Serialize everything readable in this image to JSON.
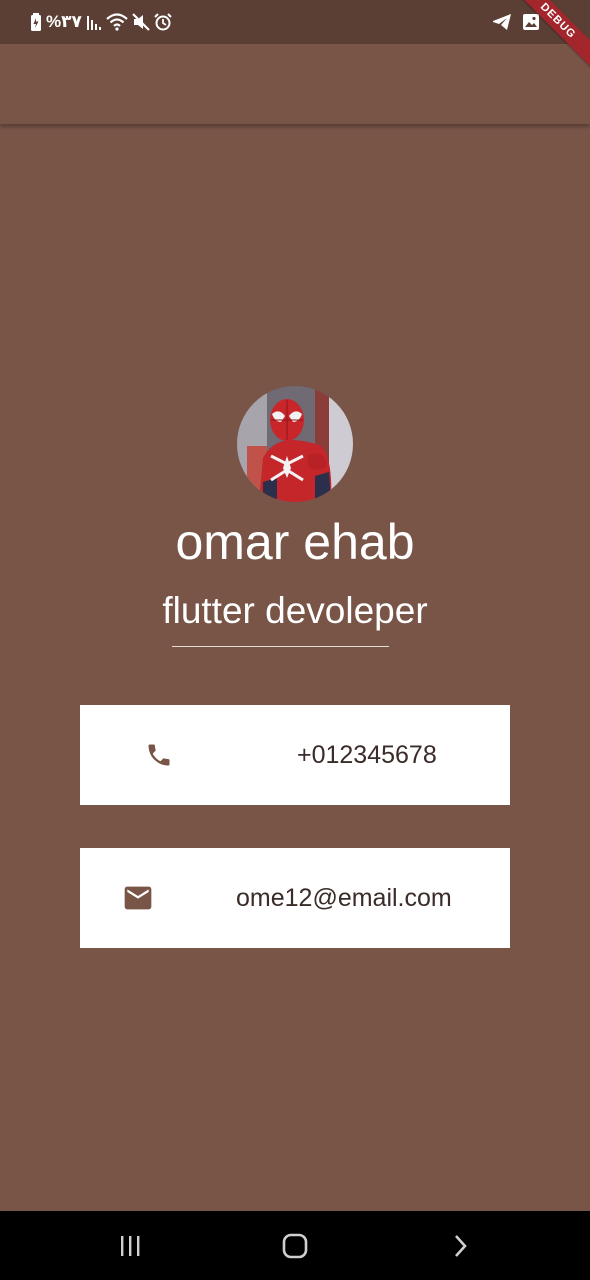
{
  "status_bar": {
    "left_text": "%٣٧",
    "icons_left": [
      "battery-saver-icon",
      "signal-icon",
      "wifi-icon",
      "mute-icon",
      "alarm-icon"
    ],
    "icons_right": [
      "telegram-icon",
      "gallery-icon"
    ]
  },
  "debug_banner": "DEBUG",
  "profile": {
    "name": "omar ehab",
    "title": "flutter devoleper"
  },
  "contacts": {
    "phone": "+012345678",
    "email": "ome12@email.com"
  },
  "colors": {
    "background": "#795548",
    "status_bar": "#5b3e34",
    "card": "#ffffff",
    "icon": "#795548",
    "nav_bar": "#000000",
    "debug_ribbon": "#a3262c"
  },
  "navigation": {
    "buttons": [
      "recent-apps-icon",
      "home-icon",
      "back-icon"
    ]
  }
}
